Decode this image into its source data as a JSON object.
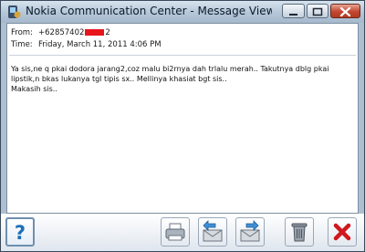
{
  "window": {
    "title": "Nokia Communication Center - Message Viewer - ..."
  },
  "message": {
    "from_label": "From:",
    "from_value_start": "+62857402",
    "from_value_end": "2",
    "time_label": "Time:",
    "time_value": "Friday, March 11, 2011 4:06 PM",
    "body": "Ya sis,ne q pkai dodora jarang2,coz malu bi2rnya dah trlalu merah.. Takutnya dblg pkai\nlipstik,n bkas lukanya tgl tipis sx.. Mellinya khasiat bgt sis..\nMakasih sis.."
  },
  "toolbar": {
    "buttons": [
      {
        "name": "help-button",
        "icon": "question-mark-icon",
        "color": "#1b6fb8"
      },
      {
        "name": "print-button",
        "icon": "printer-icon"
      },
      {
        "name": "reply-button",
        "icon": "reply-envelope-icon"
      },
      {
        "name": "forward-button",
        "icon": "forward-envelope-icon"
      },
      {
        "name": "delete-button",
        "icon": "trash-icon"
      },
      {
        "name": "close-button",
        "icon": "red-x-icon",
        "color": "#d0181f"
      }
    ]
  },
  "colors": {
    "title_bar": "#b4c6d8",
    "redaction": "#e8141c",
    "close_button": "#c3452f"
  }
}
